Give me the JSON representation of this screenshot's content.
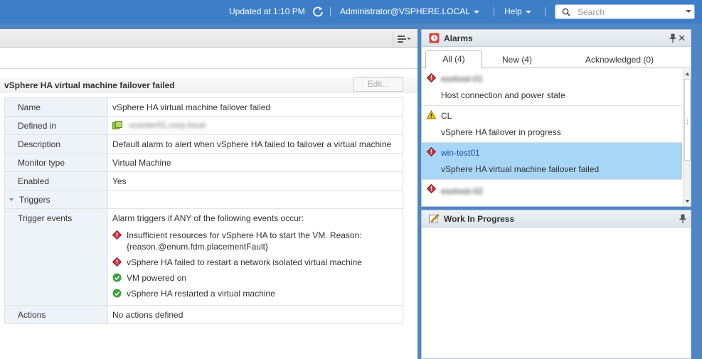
{
  "header": {
    "updated": "Updated at 1:10 PM",
    "user": "Administrator@VSPHERE.LOCAL",
    "help": "Help",
    "search_placeholder": "Search"
  },
  "alarm_definition": {
    "title": "vSphere HA virtual machine failover failed",
    "edit_label": "Edit...",
    "rows": {
      "name": {
        "key": "Name",
        "value": "vSphere HA virtual machine failover failed"
      },
      "defined_in": {
        "key": "Defined in",
        "value": "vcenter01.corp.local"
      },
      "description": {
        "key": "Description",
        "value": "Default alarm to alert when vSphere HA failed to failover a virtual machine"
      },
      "monitor_type": {
        "key": "Monitor type",
        "value": "Virtual Machine"
      },
      "enabled": {
        "key": "Enabled",
        "value": "Yes"
      },
      "triggers": {
        "key": "Triggers",
        "value": ""
      },
      "trigger_events": {
        "key": "Trigger events",
        "intro": "Alarm triggers if ANY of the following events occur:",
        "events": [
          {
            "icon": "alert-icon",
            "text": "Insufficient resources for vSphere HA to start the VM. Reason:",
            "text2": "{reason.@enum.fdm.placementFault}"
          },
          {
            "icon": "alert-icon",
            "text": "vSphere HA failed to restart a network isolated virtual machine"
          },
          {
            "icon": "ok-icon",
            "text": "VM powered on"
          },
          {
            "icon": "ok-icon",
            "text": "vSphere HA restarted a virtual machine"
          }
        ]
      },
      "actions": {
        "key": "Actions",
        "value": "No actions defined"
      }
    }
  },
  "alarms_panel": {
    "title": "Alarms",
    "tabs": [
      {
        "label": "All (4)"
      },
      {
        "label": "New (4)"
      },
      {
        "label": "Acknowledged (0)"
      }
    ],
    "items": [
      {
        "name": "esxhost-01",
        "desc": "Host connection and power state",
        "severity": "critical",
        "blurred": true
      },
      {
        "name": "CL",
        "desc": "vSphere HA failover in progress",
        "severity": "warning"
      },
      {
        "name": "win-test01",
        "desc": "vSphere HA virtual machine failover failed",
        "severity": "critical",
        "selected": true
      },
      {
        "name": "esxhost-02",
        "desc": "",
        "severity": "critical",
        "blurred": true
      }
    ]
  },
  "wip_panel": {
    "title": "Work In Progress"
  },
  "colors": {
    "topbar": "#3d7ec7",
    "selected_row": "#a8d6f7",
    "critical": "#c8343f",
    "warning": "#f2c200",
    "ok": "#3aa23a"
  }
}
